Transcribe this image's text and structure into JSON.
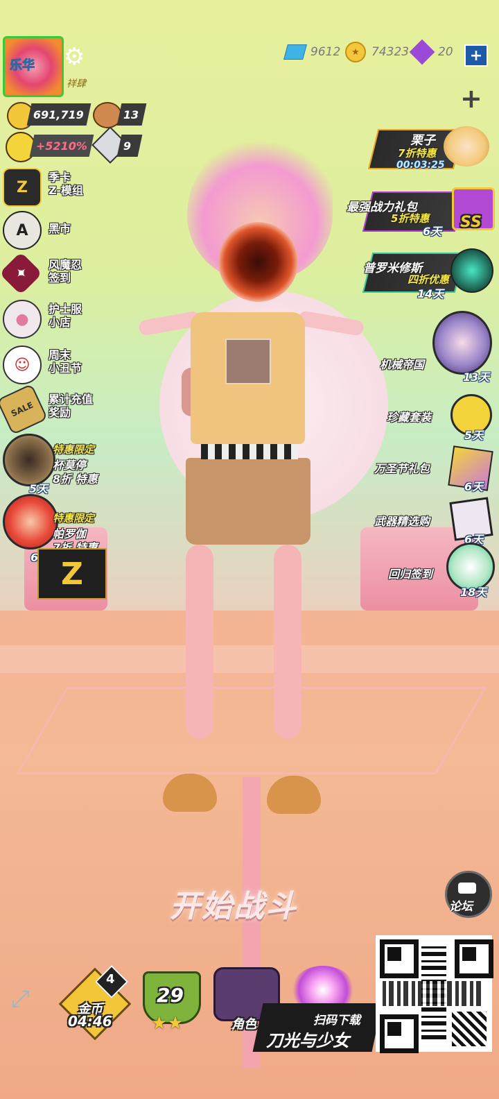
{
  "top_bar": {
    "player_name": "祥肆",
    "avatar_text": "乐华",
    "diamonds": "9612",
    "coins": "74323",
    "crystals": "20",
    "plus_label": "+",
    "more_label": "+"
  },
  "stats": {
    "trophies": "691,719",
    "bears": "13",
    "bonus": "+5210%",
    "weapon_level": "9"
  },
  "left_menu": [
    {
      "line1": "季卡",
      "line2": "Z-模组",
      "icon_char": "Z"
    },
    {
      "line1": "黑市",
      "line2": "",
      "icon_char": "A"
    },
    {
      "line1": "风魔忍",
      "line2": "签到",
      "icon_char": "✦"
    },
    {
      "line1": "护士服",
      "line2": "小店",
      "icon_char": "●"
    },
    {
      "line1": "周末",
      "line2": "小丑节",
      "icon_char": "☺"
    },
    {
      "line1": "累计充值",
      "line2": "奖励",
      "icon_char": "SALE"
    }
  ],
  "left_promos": [
    {
      "tag": "特惠限定",
      "name": "杯莫停",
      "discount": "8折 特惠",
      "days": "5天"
    },
    {
      "tag": "特惠限定",
      "name": "帕罗伽",
      "discount": "7折 特惠",
      "days": "6天"
    }
  ],
  "z_badge": "Z",
  "right_menu": {
    "chestnut": {
      "title": "栗子",
      "discount": "7折特惠",
      "timer": "00:03:25"
    },
    "power_pack": {
      "title": "最强战力礼包",
      "discount": "5折特惠",
      "days": "6天",
      "badge": "SS"
    },
    "prometheus": {
      "title": "普罗米修斯",
      "discount": "四折优惠",
      "days": "14天"
    },
    "mech_empire": {
      "title": "机械帝国",
      "days": "13天"
    },
    "collection": {
      "title": "珍藏套装",
      "days": "5天"
    },
    "halloween": {
      "title": "万圣节礼包",
      "days": "6天"
    },
    "weapon_pick": {
      "title": "武器精选购",
      "days": "6天"
    },
    "return_signin": {
      "title": "回归签到",
      "days": "18天"
    }
  },
  "bottom": {
    "start_battle": "开始战斗",
    "forum": "论坛",
    "gold_label": "金币",
    "gold_timer": "04:46",
    "gold_count": "4",
    "level": "29",
    "role_label": "角色",
    "scan_download": "扫码下载",
    "game_title": "刀光与少女"
  },
  "colors": {
    "accent_blue": "#1f5aa8",
    "gold": "#f2c83a",
    "pink_bg": "#f0b896"
  }
}
